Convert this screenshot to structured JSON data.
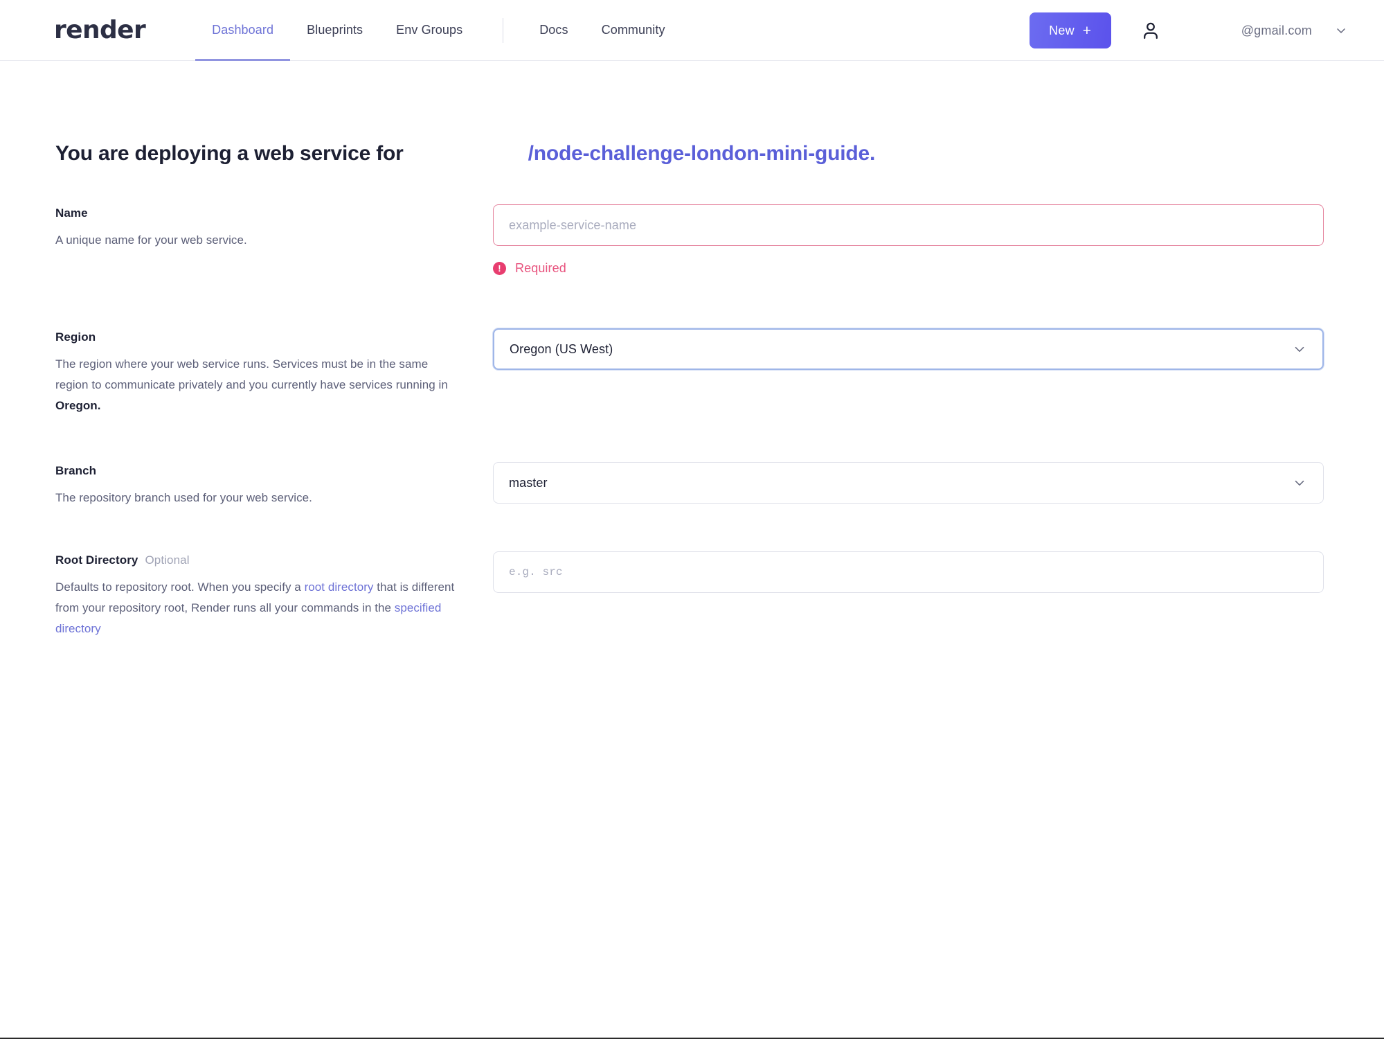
{
  "brand": {
    "logo_text": "render",
    "accent_color": "#5a5fd8",
    "error_color": "#e83d6f"
  },
  "nav": {
    "links": [
      {
        "label": "Dashboard",
        "active": true
      },
      {
        "label": "Blueprints",
        "active": false
      },
      {
        "label": "Env Groups",
        "active": false
      },
      {
        "label": "Docs",
        "active": false
      },
      {
        "label": "Community",
        "active": false
      }
    ],
    "new_button": {
      "label": "New",
      "plus": "+"
    },
    "avatar_icon": "person-icon",
    "account": {
      "email": "@gmail.com",
      "caret_icon": "chevron-down-icon"
    }
  },
  "heading": {
    "lead": "You are deploying a web service for",
    "owner": "",
    "repo": "/node-challenge-london-mini-guide."
  },
  "form": {
    "name": {
      "title": "Name",
      "description": "A unique name for your web service.",
      "placeholder": "example-service-name",
      "value": "",
      "error": "Required",
      "error_icon": "exclamation-circle-icon"
    },
    "region": {
      "title": "Region",
      "desc_part1": "The region where your web service runs. Services must be in the same region to communicate privately and you currently have services running in ",
      "desc_bold": "Oregon.",
      "selected": "Oregon (US West)",
      "caret_icon": "chevron-down-icon"
    },
    "branch": {
      "title": "Branch",
      "description": "The repository branch used for your web service.",
      "selected": "master",
      "caret_icon": "chevron-down-icon"
    },
    "root_directory": {
      "title": "Root Directory",
      "optional": "Optional",
      "desc_part1": "Defaults to repository root. When you specify a ",
      "desc_link1": "root directory",
      "desc_part2": " that is different from your repository root, Render runs all your commands in the ",
      "desc_link2": "specified directory",
      "placeholder": "e.g. src",
      "value": ""
    }
  }
}
